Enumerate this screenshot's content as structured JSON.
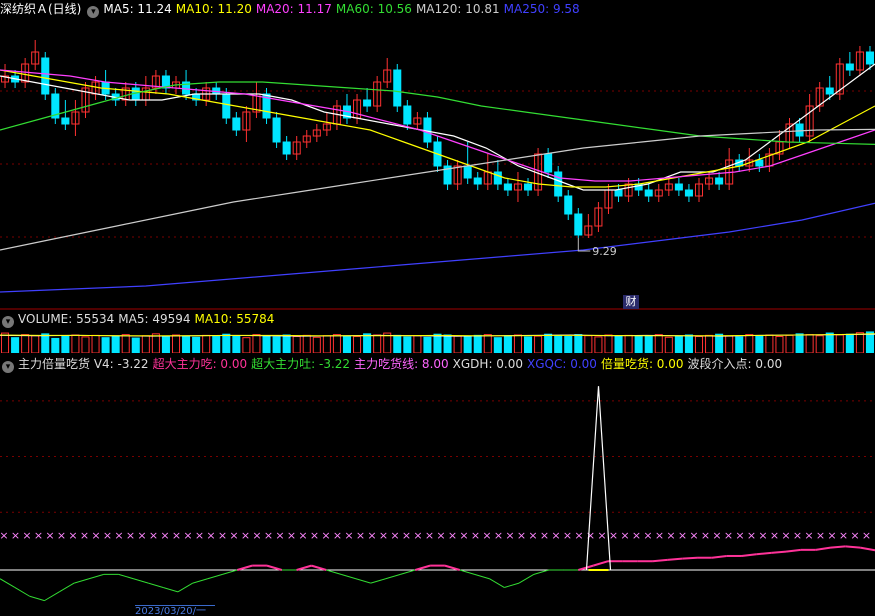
{
  "price_header": {
    "title": "深纺织Ａ(日线)",
    "items": [
      {
        "label": "MA5: 11.24",
        "color": "#ffffff"
      },
      {
        "label": "MA10: 11.20",
        "color": "#ffff00"
      },
      {
        "label": "MA20: 11.17",
        "color": "#ff40ff"
      },
      {
        "label": "MA60: 10.56",
        "color": "#33dd33"
      },
      {
        "label": "MA120: 10.81",
        "color": "#cccccc"
      },
      {
        "label": "MA250: 9.58",
        "color": "#4040ff"
      }
    ]
  },
  "volume_header": {
    "items": [
      {
        "label": "VOLUME: 55534",
        "color": "#dddddd"
      },
      {
        "label": "MA5: 49594",
        "color": "#dddddd"
      },
      {
        "label": "MA10: 55784",
        "color": "#ffff00"
      }
    ]
  },
  "indicator_header": {
    "items": [
      {
        "label": "主力倍量吃货  V4: -3.22",
        "color": "#dddddd"
      },
      {
        "label": "超大主力吃: 0.00",
        "color": "#ff3399"
      },
      {
        "label": "超大主力吐: -3.22",
        "color": "#33dd33"
      },
      {
        "label": "主力吃货线: 8.00",
        "color": "#ff66ff"
      },
      {
        "label": "XGDH: 0.00",
        "color": "#dddddd"
      },
      {
        "label": "XGQC: 0.00",
        "color": "#4040ff"
      },
      {
        "label": "倍量吃货: 0.00",
        "color": "#ffff00"
      },
      {
        "label": "波段介入点: 0.00",
        "color": "#dddddd"
      }
    ]
  },
  "price_low_label": "9.29",
  "finance_marker": "财",
  "date_label": "2023/03/20/一",
  "colors": {
    "up": "#ff3232",
    "down": "#00e5ff",
    "grid": "#7a0000"
  },
  "chart_data": {
    "type": "candlestick",
    "title": "深纺织Ａ(日线)",
    "candles": [
      [
        11.6,
        11.7,
        11.9,
        11.5
      ],
      [
        11.7,
        11.6,
        11.8,
        11.5
      ],
      [
        11.6,
        11.9,
        12.0,
        11.5
      ],
      [
        11.9,
        12.1,
        12.3,
        11.8
      ],
      [
        12.0,
        11.4,
        12.1,
        11.3
      ],
      [
        11.4,
        11.0,
        11.5,
        10.9
      ],
      [
        11.0,
        10.9,
        11.3,
        10.8
      ],
      [
        10.9,
        11.1,
        11.3,
        10.7
      ],
      [
        11.1,
        11.5,
        11.6,
        11.0
      ],
      [
        11.4,
        11.6,
        11.7,
        11.3
      ],
      [
        11.6,
        11.4,
        11.8,
        11.3
      ],
      [
        11.4,
        11.3,
        11.5,
        11.2
      ],
      [
        11.3,
        11.5,
        11.6,
        11.2
      ],
      [
        11.5,
        11.3,
        11.6,
        11.2
      ],
      [
        11.3,
        11.5,
        11.7,
        11.2
      ],
      [
        11.5,
        11.7,
        11.8,
        11.4
      ],
      [
        11.7,
        11.5,
        11.8,
        11.4
      ],
      [
        11.5,
        11.6,
        11.7,
        11.4
      ],
      [
        11.6,
        11.4,
        11.8,
        11.3
      ],
      [
        11.4,
        11.3,
        11.5,
        11.2
      ],
      [
        11.3,
        11.5,
        11.6,
        11.2
      ],
      [
        11.5,
        11.4,
        11.6,
        11.3
      ],
      [
        11.4,
        11.0,
        11.5,
        10.9
      ],
      [
        11.0,
        10.8,
        11.1,
        10.7
      ],
      [
        10.8,
        11.1,
        11.2,
        10.6
      ],
      [
        11.1,
        11.4,
        11.6,
        11.0
      ],
      [
        11.4,
        11.0,
        11.5,
        10.9
      ],
      [
        11.0,
        10.6,
        11.1,
        10.5
      ],
      [
        10.6,
        10.4,
        10.7,
        10.3
      ],
      [
        10.4,
        10.6,
        10.7,
        10.3
      ],
      [
        10.6,
        10.7,
        10.8,
        10.5
      ],
      [
        10.7,
        10.8,
        10.9,
        10.6
      ],
      [
        10.8,
        10.9,
        11.1,
        10.7
      ],
      [
        10.9,
        11.2,
        11.3,
        10.8
      ],
      [
        11.2,
        11.0,
        11.4,
        10.9
      ],
      [
        11.0,
        11.3,
        11.4,
        10.9
      ],
      [
        11.3,
        11.2,
        11.5,
        11.1
      ],
      [
        11.2,
        11.6,
        11.7,
        11.1
      ],
      [
        11.6,
        11.8,
        12.0,
        11.5
      ],
      [
        11.8,
        11.2,
        11.9,
        11.1
      ],
      [
        11.2,
        10.9,
        11.3,
        10.8
      ],
      [
        10.9,
        11.0,
        11.1,
        10.8
      ],
      [
        11.0,
        10.6,
        11.1,
        10.5
      ],
      [
        10.6,
        10.2,
        10.7,
        10.1
      ],
      [
        10.2,
        9.9,
        10.3,
        9.8
      ],
      [
        9.9,
        10.2,
        10.3,
        9.8
      ],
      [
        10.2,
        10.0,
        10.6,
        9.9
      ],
      [
        10.0,
        9.9,
        10.1,
        9.8
      ],
      [
        9.9,
        10.1,
        10.4,
        9.8
      ],
      [
        10.1,
        9.9,
        10.3,
        9.8
      ],
      [
        9.9,
        9.8,
        10.0,
        9.7
      ],
      [
        9.8,
        9.9,
        10.1,
        9.6
      ],
      [
        9.9,
        9.8,
        10.0,
        9.7
      ],
      [
        9.8,
        10.4,
        10.5,
        9.7
      ],
      [
        10.4,
        10.1,
        10.5,
        10.0
      ],
      [
        10.1,
        9.7,
        10.2,
        9.6
      ],
      [
        9.7,
        9.4,
        9.8,
        9.3
      ],
      [
        9.4,
        9.05,
        9.5,
        9.0
      ],
      [
        9.05,
        9.2,
        9.4,
        9.0
      ],
      [
        9.2,
        9.5,
        9.6,
        9.1
      ],
      [
        9.5,
        9.8,
        9.9,
        9.4
      ],
      [
        9.8,
        9.7,
        9.9,
        9.6
      ],
      [
        9.7,
        9.9,
        10.0,
        9.6
      ],
      [
        9.9,
        9.8,
        10.0,
        9.7
      ],
      [
        9.8,
        9.7,
        9.9,
        9.6
      ],
      [
        9.7,
        9.8,
        9.9,
        9.6
      ],
      [
        9.8,
        9.9,
        10.0,
        9.7
      ],
      [
        9.9,
        9.8,
        10.0,
        9.7
      ],
      [
        9.8,
        9.7,
        9.9,
        9.6
      ],
      [
        9.7,
        9.9,
        10.0,
        9.6
      ],
      [
        9.9,
        10.0,
        10.1,
        9.8
      ],
      [
        10.0,
        9.9,
        10.1,
        9.8
      ],
      [
        9.9,
        10.3,
        10.5,
        9.8
      ],
      [
        10.3,
        10.2,
        10.4,
        10.1
      ],
      [
        10.2,
        10.3,
        10.5,
        10.1
      ],
      [
        10.3,
        10.2,
        10.4,
        10.1
      ],
      [
        10.2,
        10.4,
        10.5,
        10.1
      ],
      [
        10.4,
        10.6,
        10.8,
        10.3
      ],
      [
        10.6,
        10.9,
        11.0,
        10.5
      ],
      [
        10.9,
        10.7,
        11.0,
        10.6
      ],
      [
        10.7,
        11.2,
        11.4,
        10.6
      ],
      [
        11.2,
        11.5,
        11.6,
        11.1
      ],
      [
        11.5,
        11.4,
        11.7,
        11.3
      ],
      [
        11.4,
        11.9,
        12.0,
        11.3
      ],
      [
        11.9,
        11.8,
        12.1,
        11.7
      ],
      [
        11.8,
        12.1,
        12.2,
        11.7
      ],
      [
        12.1,
        11.9,
        12.2,
        11.8
      ]
    ],
    "moving_averages": [
      {
        "name": "MA5",
        "color": "#ffffff",
        "values": [
          11.7,
          11.6,
          11.5,
          11.4,
          11.3,
          11.3,
          11.4,
          11.4,
          11.4,
          11.3,
          11.1,
          11.0,
          10.9,
          10.8,
          10.7,
          10.5,
          10.2,
          10.0,
          9.8,
          9.8,
          9.9,
          10.1,
          10.1,
          10.3,
          10.7,
          11.1,
          11.5,
          11.9
        ]
      },
      {
        "name": "MA10",
        "color": "#ffff00",
        "values": [
          11.8,
          11.7,
          11.6,
          11.5,
          11.45,
          11.4,
          11.3,
          11.2,
          11.1,
          11.0,
          10.9,
          10.8,
          10.6,
          10.4,
          10.2,
          10.0,
          9.9,
          9.85,
          9.85,
          9.9,
          10.0,
          10.1,
          10.2,
          10.4,
          10.6,
          10.9,
          11.2
        ]
      },
      {
        "name": "MA20",
        "color": "#ff40ff",
        "values": [
          11.8,
          11.75,
          11.7,
          11.6,
          11.55,
          11.5,
          11.45,
          11.4,
          11.3,
          11.2,
          11.1,
          10.95,
          10.8,
          10.6,
          10.4,
          10.2,
          10.0,
          9.95,
          9.95,
          10.0,
          10.05,
          10.1,
          10.2,
          10.4,
          10.6,
          10.8
        ]
      },
      {
        "name": "MA60",
        "color": "#33dd33",
        "values": [
          10.8,
          11.0,
          11.2,
          11.4,
          11.55,
          11.6,
          11.6,
          11.55,
          11.5,
          11.45,
          11.35,
          11.2,
          11.1,
          11.0,
          10.9,
          10.8,
          10.7,
          10.65,
          10.6,
          10.58,
          10.56
        ]
      },
      {
        "name": "MA120",
        "color": "#cccccc",
        "values": [
          8.8,
          9.0,
          9.2,
          9.4,
          9.6,
          9.75,
          9.9,
          10.05,
          10.2,
          10.35,
          10.5,
          10.6,
          10.7,
          10.75,
          10.8,
          10.81
        ]
      },
      {
        "name": "MA250",
        "color": "#4040ff",
        "values": [
          8.1,
          8.15,
          8.2,
          8.3,
          8.4,
          8.5,
          8.6,
          8.7,
          8.8,
          8.95,
          9.1,
          9.3,
          9.58
        ]
      }
    ],
    "volume": {
      "values": [
        52,
        40,
        48,
        45,
        50,
        38,
        44,
        47,
        42,
        46,
        40,
        43,
        48,
        39,
        45,
        50,
        42,
        47,
        44,
        41,
        46,
        43,
        49,
        45,
        40,
        48,
        44,
        42,
        47,
        43,
        46,
        41,
        45,
        48,
        44,
        43,
        50,
        47,
        52,
        46,
        42,
        45,
        41,
        49,
        47,
        44,
        43,
        46,
        48,
        40,
        45,
        47,
        42,
        44,
        49,
        46,
        43,
        48,
        45,
        42,
        47,
        44,
        46,
        43,
        45,
        48,
        41,
        44,
        47,
        43,
        46,
        49,
        44,
        42,
        48,
        45,
        47,
        43,
        46,
        50,
        48,
        45,
        52,
        47,
        49,
        53,
        55
      ],
      "ma5": [
        46,
        45,
        46,
        45,
        44,
        45,
        46,
        45,
        44,
        45,
        46,
        45,
        44,
        45,
        46,
        47,
        45,
        46,
        45,
        44,
        46,
        47,
        48,
        49
      ],
      "ma10": [
        47,
        46,
        46,
        45,
        45,
        45,
        46,
        46,
        45,
        45,
        45,
        46,
        45,
        45,
        46,
        46,
        45,
        45,
        45,
        46,
        47,
        48,
        50
      ]
    },
    "indicator": {
      "line_ref": 8.0,
      "spike_index": 0.684,
      "oscillator": [
        -2,
        -4,
        -6,
        -7,
        -5,
        -3,
        -2,
        -1,
        -1,
        -2,
        -3,
        -4,
        -5,
        -3,
        -2,
        -1,
        0,
        1,
        1,
        0,
        0,
        1,
        0,
        -1,
        -2,
        -3,
        -2,
        -1,
        0,
        1,
        1,
        0,
        -1,
        -2,
        -4,
        -3,
        -1,
        0,
        0,
        0,
        1,
        2,
        2,
        2,
        2,
        2.3,
        2.6,
        2.8,
        2.8,
        3.2,
        3.2,
        3.6,
        3.9,
        4.2,
        4.6,
        4.6,
        5.1,
        5.4,
        5.1,
        4.5
      ],
      "oscillator_start": 0.0
    }
  }
}
